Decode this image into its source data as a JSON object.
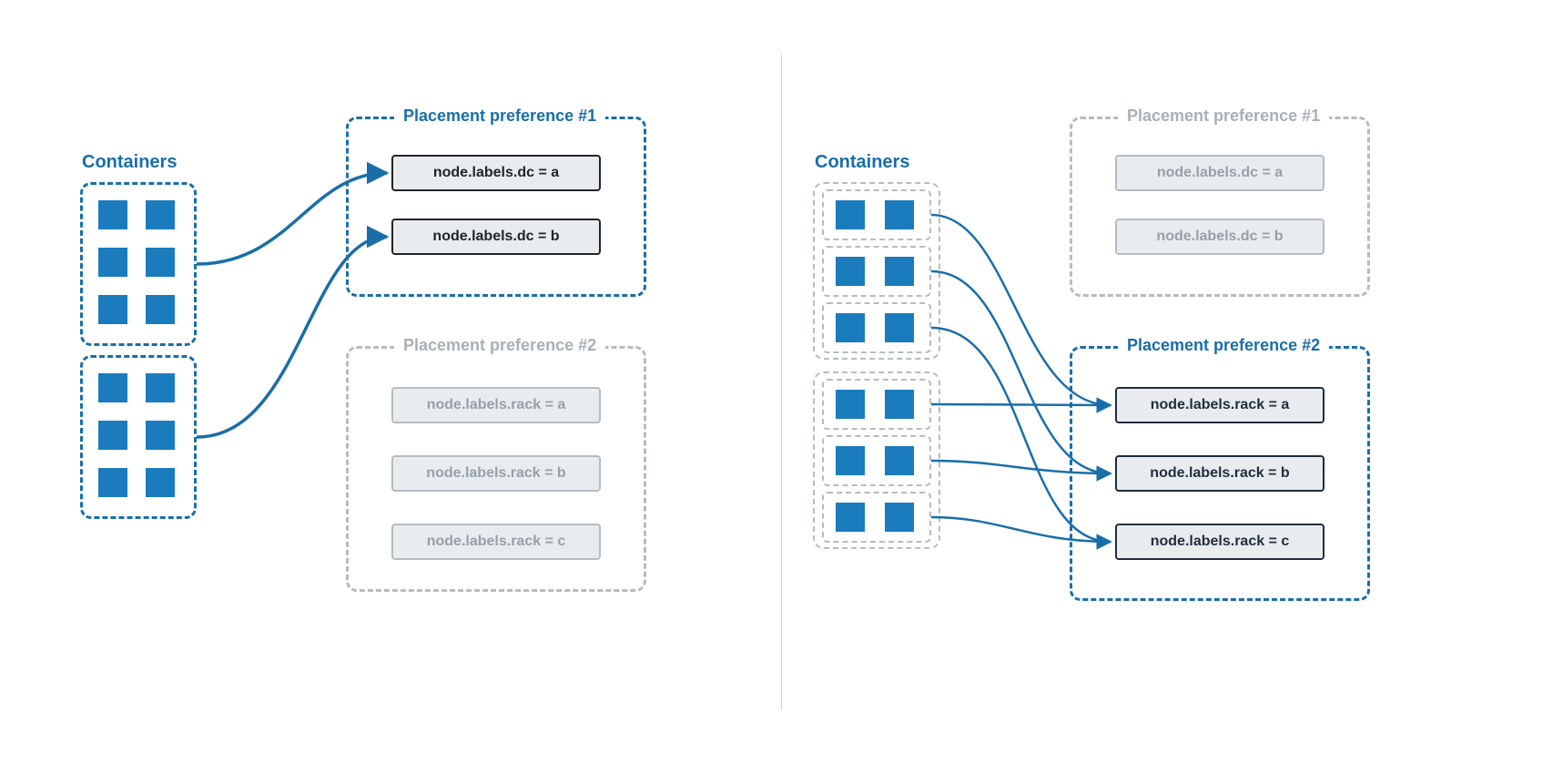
{
  "left": {
    "containers_title": "Containers",
    "pref1": {
      "title": "Placement preference #1",
      "nodes": [
        "node.labels.dc = a",
        "node.labels.dc = b"
      ]
    },
    "pref2": {
      "title": "Placement preference #2",
      "nodes": [
        "node.labels.rack = a",
        "node.labels.rack = b",
        "node.labels.rack = c"
      ]
    }
  },
  "right": {
    "containers_title": "Containers",
    "pref1": {
      "title": "Placement preference #1",
      "nodes": [
        "node.labels.dc = a",
        "node.labels.dc = b"
      ]
    },
    "pref2": {
      "title": "Placement preference #2",
      "nodes": [
        "node.labels.rack = a",
        "node.labels.rack = b",
        "node.labels.rack = c"
      ]
    }
  }
}
